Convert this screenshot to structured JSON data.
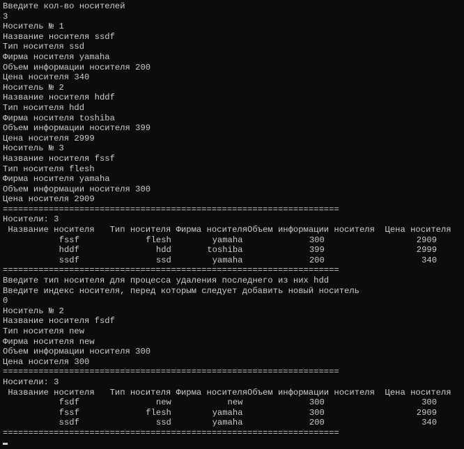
{
  "colors": {
    "background": "#0c0c0c",
    "text": "#cccccc"
  },
  "separator": "==================================================================",
  "table_header": " Название носителя   Тип носителя Фирма носителяОбъем информации носителя  Цена носителя",
  "lines": [
    {
      "kind": "text",
      "text": "Введите кол-во носителей"
    },
    {
      "kind": "text",
      "text": "3"
    },
    {
      "kind": "text",
      "text": "Носитель № 1"
    },
    {
      "kind": "text",
      "text": "Название носителя ssdf"
    },
    {
      "kind": "text",
      "text": "Тип носителя ssd"
    },
    {
      "kind": "text",
      "text": "Фирма носителя yamaha"
    },
    {
      "kind": "text",
      "text": "Объем информации носителя 200"
    },
    {
      "kind": "text",
      "text": "Цена носителя 340"
    },
    {
      "kind": "text",
      "text": "Носитель № 2"
    },
    {
      "kind": "text",
      "text": "Название носителя hddf"
    },
    {
      "kind": "text",
      "text": "Тип носителя hdd"
    },
    {
      "kind": "text",
      "text": "Фирма носителя toshiba"
    },
    {
      "kind": "text",
      "text": "Объем информации носителя 399"
    },
    {
      "kind": "text",
      "text": "Цена носителя 2999"
    },
    {
      "kind": "text",
      "text": "Носитель № 3"
    },
    {
      "kind": "text",
      "text": "Название носителя fssf"
    },
    {
      "kind": "text",
      "text": "Тип носителя flesh"
    },
    {
      "kind": "text",
      "text": "Фирма носителя yamaha"
    },
    {
      "kind": "text",
      "text": "Объем информации носителя 300"
    },
    {
      "kind": "text",
      "text": "Цена носителя 2909"
    },
    {
      "kind": "sep"
    },
    {
      "kind": "text",
      "text": "Носители: 3"
    },
    {
      "kind": "header"
    },
    {
      "kind": "row",
      "cells": [
        "fssf",
        "flesh",
        "yamaha",
        "300",
        "2909"
      ]
    },
    {
      "kind": "row",
      "cells": [
        "hddf",
        "hdd",
        "toshiba",
        "399",
        "2999"
      ]
    },
    {
      "kind": "row",
      "cells": [
        "ssdf",
        "ssd",
        "yamaha",
        "200",
        "340"
      ]
    },
    {
      "kind": "sep"
    },
    {
      "kind": "text",
      "text": "Введите тип носителя для процесса удаления последнего из них hdd"
    },
    {
      "kind": "text",
      "text": "Введите индекс носителя, перед которым следует добавить новый носитель"
    },
    {
      "kind": "text",
      "text": "0"
    },
    {
      "kind": "text",
      "text": "Носитель № 2"
    },
    {
      "kind": "text",
      "text": "Название носителя fsdf"
    },
    {
      "kind": "text",
      "text": "Тип носителя new"
    },
    {
      "kind": "text",
      "text": "Фирма носителя new"
    },
    {
      "kind": "text",
      "text": "Объем информации носителя 300"
    },
    {
      "kind": "text",
      "text": "Цена носителя 300"
    },
    {
      "kind": "sep"
    },
    {
      "kind": "text",
      "text": "Носители: 3"
    },
    {
      "kind": "header"
    },
    {
      "kind": "row",
      "cells": [
        "fsdf",
        "new",
        "new",
        "300",
        "300"
      ]
    },
    {
      "kind": "row",
      "cells": [
        "fssf",
        "flesh",
        "yamaha",
        "300",
        "2909"
      ]
    },
    {
      "kind": "row",
      "cells": [
        "ssdf",
        "ssd",
        "yamaha",
        "200",
        "340"
      ]
    },
    {
      "kind": "sep"
    }
  ]
}
